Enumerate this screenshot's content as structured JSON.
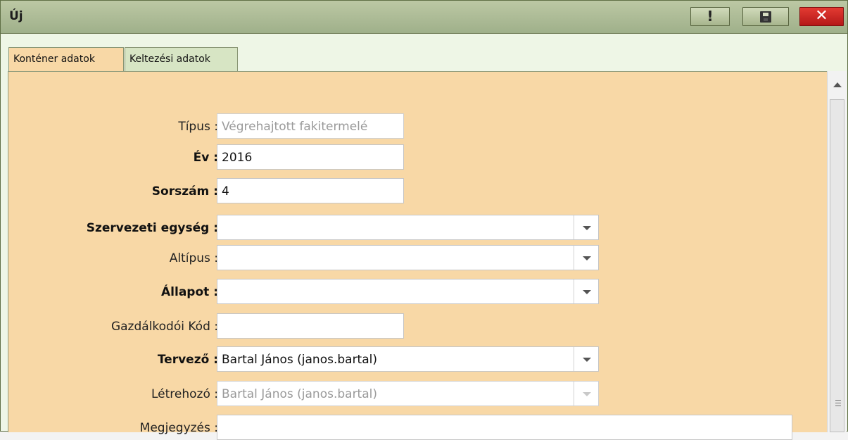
{
  "window": {
    "title": "Új",
    "buttons": {
      "warning": "warning-icon",
      "save": "save-icon",
      "close": "close-icon"
    }
  },
  "tabs": [
    {
      "label": "Konténer adatok",
      "active": true
    },
    {
      "label": "Keltezési adatok",
      "active": false
    }
  ],
  "form": {
    "tipus": {
      "label": "Típus :",
      "value": "Végrehajtott fakitermelé"
    },
    "ev": {
      "label": "Év :",
      "value": "2016"
    },
    "sorszam": {
      "label": "Sorszám :",
      "value": "4"
    },
    "szervezeti_egyseg": {
      "label": "Szervezeti egység :",
      "value": ""
    },
    "altipus": {
      "label": "Altípus :",
      "value": ""
    },
    "allapot": {
      "label": "Állapot :",
      "value": ""
    },
    "gazdalkodoi_kod": {
      "label": "Gazdálkodói Kód :",
      "value": ""
    },
    "tervezo": {
      "label": "Tervező :",
      "value": "Bartal János (janos.bartal)"
    },
    "letrehozo": {
      "label": "Létrehozó :",
      "value": "Bartal János (janos.bartal)"
    },
    "megjegyzes": {
      "label": "Megjegyzés :",
      "value": ""
    }
  },
  "colors": {
    "titlebar": "#a7b58d",
    "panel": "#f8d8a6",
    "close": "#d82d28"
  }
}
